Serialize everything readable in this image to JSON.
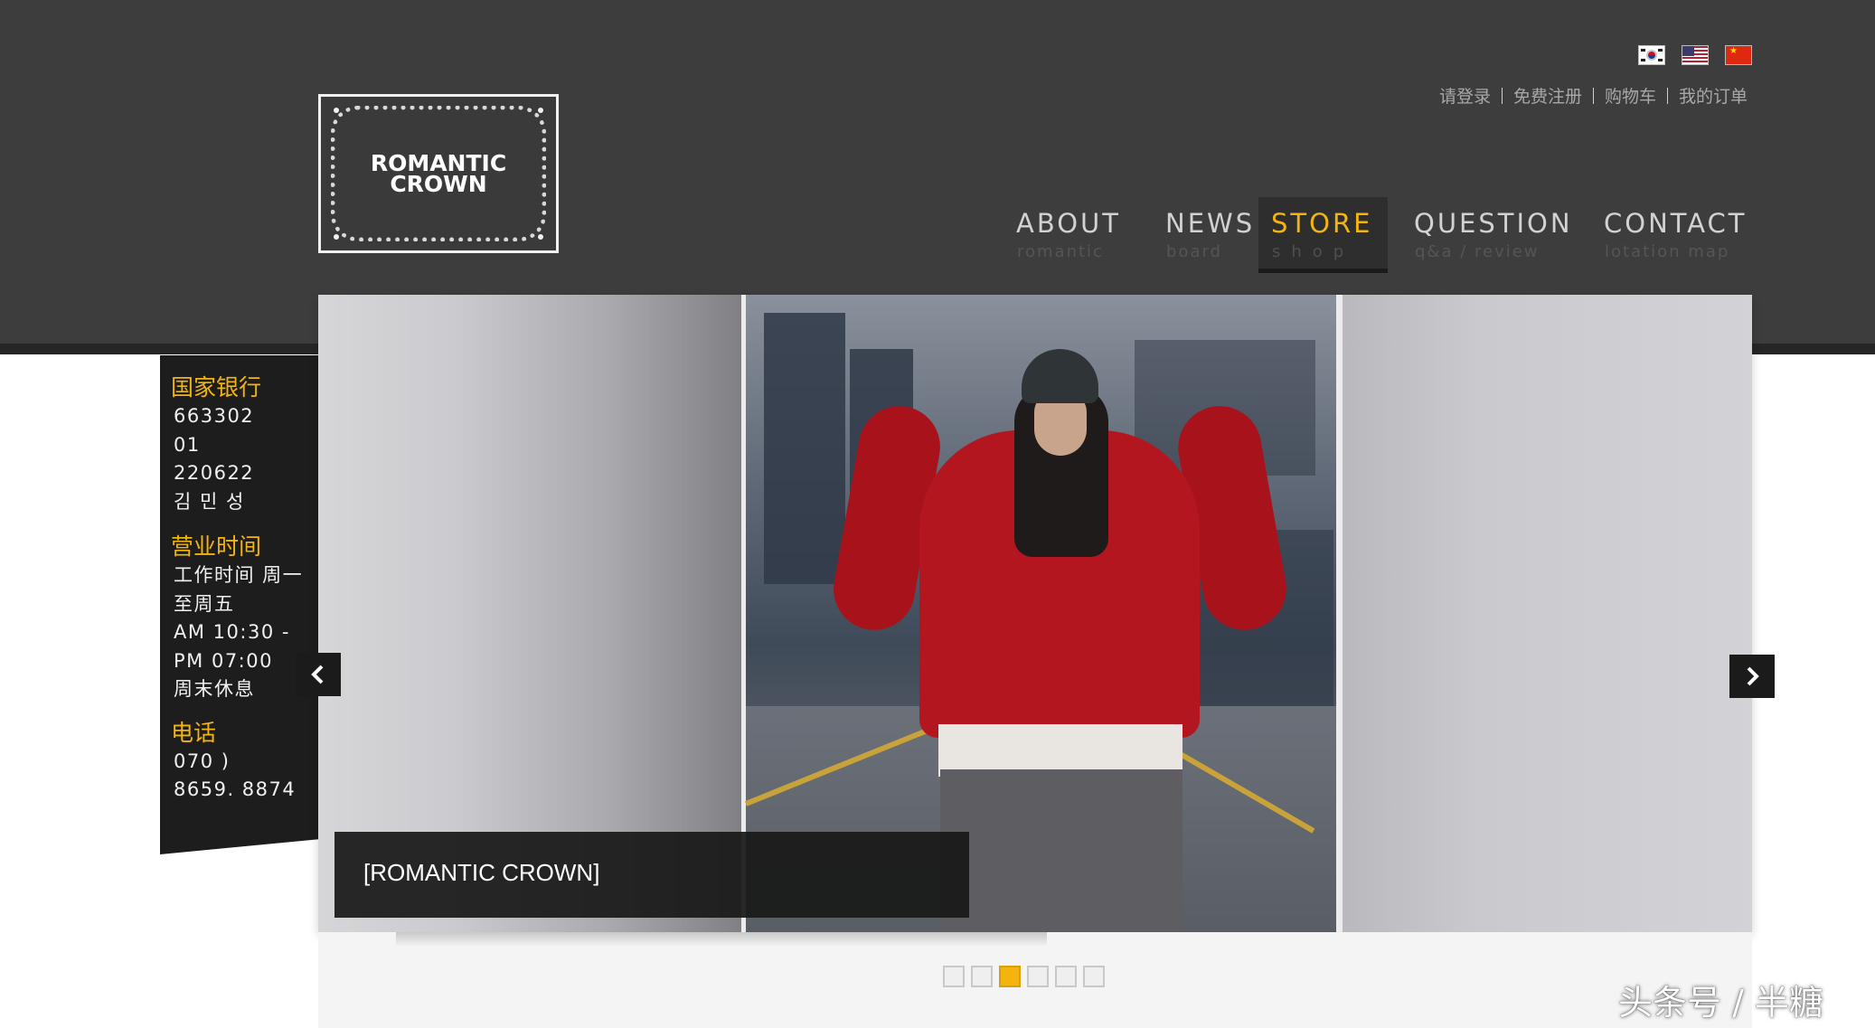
{
  "top_links": [
    "请登录",
    "免费注册",
    "购物车",
    "我的订单"
  ],
  "flags": [
    "korea-flag-icon",
    "usa-flag-icon",
    "china-flag-icon"
  ],
  "logo": {
    "line1": "ROMANTIC",
    "line2": "CROWN"
  },
  "nav": [
    {
      "label": "ABOUT",
      "sub": "romantic",
      "active": false
    },
    {
      "label": "NEWS",
      "sub": "board",
      "active": false
    },
    {
      "label": "STORE",
      "sub": "shop",
      "active": true
    },
    {
      "label": "QUESTION",
      "sub": "q&a / review",
      "active": false
    },
    {
      "label": "CONTACT",
      "sub": "lotation map",
      "active": false
    }
  ],
  "info": {
    "bank_title": "国家银行",
    "bank_lines": [
      "663302",
      "01",
      "220622",
      "김 민 성"
    ],
    "hours_title": "营业时间",
    "hours_lines": [
      "工作时间 周一",
      "至周五",
      "AM 10:30 -",
      "PM 07:00",
      "周末休息"
    ],
    "phone_title": "电话",
    "phone_lines": [
      "070 )",
      "8659. 8874"
    ]
  },
  "slider": {
    "caption": "[ROMANTIC CROWN]",
    "prev_icon": "chevron-left-icon",
    "next_icon": "chevron-right-icon",
    "total_slides": 6,
    "active_slide": 3
  },
  "watermark": "头条号 / 半糖",
  "colors": {
    "accent": "#f2b40d",
    "header_bg": "#3d3d3d",
    "panel_bg": "#1d1d1d"
  }
}
